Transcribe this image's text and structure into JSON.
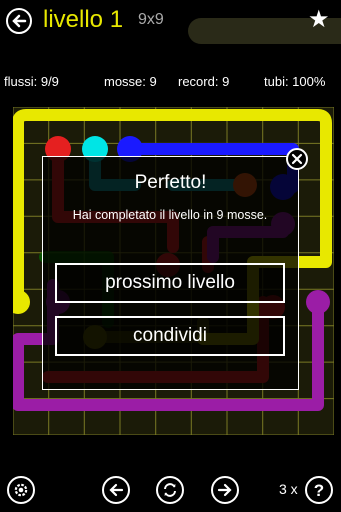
{
  "header": {
    "title": "livello 1",
    "grid_size": "9x9",
    "star_icon": "star-icon",
    "back_icon": "back-arrow-icon"
  },
  "stats": {
    "flows": "flussi: 9/9",
    "moves": "mosse: 9",
    "record": "record: 9",
    "pipe": "tubi: 100%"
  },
  "dialog": {
    "title": "Perfetto!",
    "message": "Hai completato il livello in 9 mosse.",
    "next_button": "prossimo livello",
    "share_button": "condividi",
    "close_icon": "close-icon"
  },
  "footer": {
    "hints": "3 x",
    "settings_icon": "gear-icon",
    "prev_icon": "arrow-left-icon",
    "restart_icon": "restart-icon",
    "next_icon": "arrow-right-icon",
    "help_icon": "help-icon"
  },
  "colors": {
    "yellow": "#e8e800",
    "red": "#e52020",
    "cyan": "#00e5e5",
    "blue": "#1a1aff",
    "teal": "#14a0a0",
    "orange": "#e85a14",
    "purple": "#9b1da6",
    "green": "#007a00",
    "tan": "#a0a000",
    "grid": "#8a8a2a"
  }
}
